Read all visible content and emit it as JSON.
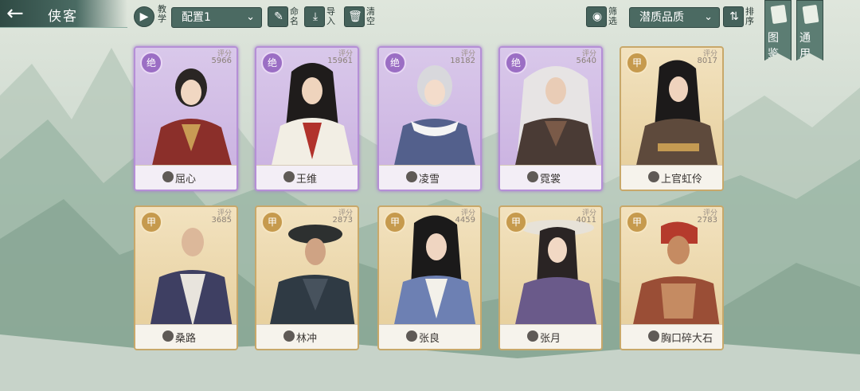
{
  "header": {
    "title": "侠客",
    "tutorial_label": "教学",
    "config_value": "配置1",
    "rename_label": "命名",
    "import_label": "导入",
    "clear_label": "清空",
    "filter_label": "筛选",
    "sort_select_value": "潜质品质",
    "sort_label": "排序",
    "atlas_label": "图鉴",
    "general_label": "通用"
  },
  "heroes": [
    {
      "name": "屈心",
      "rank": "绝",
      "score_label": "评分",
      "score": "5966",
      "tier": "purple",
      "icon": "taiji-icon"
    },
    {
      "name": "王维",
      "rank": "绝",
      "score_label": "评分",
      "score": "15961",
      "tier": "purple",
      "icon": "taiji-icon"
    },
    {
      "name": "凌雪",
      "rank": "绝",
      "score_label": "评分",
      "score": "18182",
      "tier": "purple",
      "icon": "sword-icon"
    },
    {
      "name": "霓裳",
      "rank": "绝",
      "score_label": "评分",
      "score": "5640",
      "tier": "purple",
      "icon": "taiji-icon"
    },
    {
      "name": "上官虹伶",
      "rank": "甲",
      "score_label": "评分",
      "score": "8017",
      "tier": "gold",
      "icon": "taiji-icon"
    },
    {
      "name": "桑路",
      "rank": "甲",
      "score_label": "评分",
      "score": "3685",
      "tier": "gold",
      "icon": "sword-icon"
    },
    {
      "name": "林冲",
      "rank": "甲",
      "score_label": "评分",
      "score": "2873",
      "tier": "gold",
      "icon": "sword-icon"
    },
    {
      "name": "张良",
      "rank": "甲",
      "score_label": "评分",
      "score": "4459",
      "tier": "gold",
      "icon": "taiji-icon"
    },
    {
      "name": "张月",
      "rank": "甲",
      "score_label": "评分",
      "score": "4011",
      "tier": "gold",
      "icon": "shield-icon"
    },
    {
      "name": "胸口碎大石",
      "rank": "甲",
      "score_label": "评分",
      "score": "2783",
      "tier": "gold",
      "icon": "shield-icon"
    }
  ],
  "colors": {
    "purple_frame": "#b58fd6",
    "gold_frame": "#c8a86a",
    "toolbar": "#45625b"
  }
}
